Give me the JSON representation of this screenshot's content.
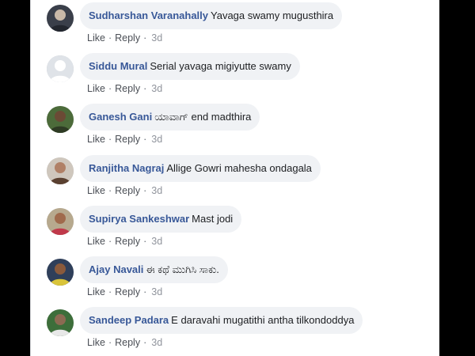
{
  "comments": [
    {
      "author": "Sudharshan Varanahally",
      "text": "Yavaga swamy mugusthira",
      "like": "Like",
      "reply": "Reply",
      "sep": "·",
      "time": "3d",
      "avatar": {
        "bg": "#3a3f4a",
        "fg": "#c9b9a8",
        "shirt": "#22262e"
      }
    },
    {
      "author": "Siddu Mural",
      "text": "Serial yavaga migiyutte swamy",
      "like": "Like",
      "reply": "Reply",
      "sep": "·",
      "time": "3d",
      "avatar": {
        "bg": "#dfe3e8",
        "fg": "#ffffff",
        "shirt": "#ffffff"
      }
    },
    {
      "author": "Ganesh Gani",
      "text": "ಯಾವಾಗ್ end madthira",
      "like": "Like",
      "reply": "Reply",
      "sep": "·",
      "time": "3d",
      "avatar": {
        "bg": "#4c6b3a",
        "fg": "#6b4a35",
        "shirt": "#2e3b24"
      }
    },
    {
      "author": "Ranjitha Nagraj",
      "text": "Allige Gowri mahesha ondagala",
      "like": "Like",
      "reply": "Reply",
      "sep": "·",
      "time": "3d",
      "avatar": {
        "bg": "#cfc7bd",
        "fg": "#b08066",
        "shirt": "#5a4030"
      }
    },
    {
      "author": "Supirya Sankeshwar",
      "text": "Mast jodi",
      "like": "Like",
      "reply": "Reply",
      "sep": "·",
      "time": "3d",
      "avatar": {
        "bg": "#b7a98e",
        "fg": "#a06a4c",
        "shirt": "#c0394a"
      }
    },
    {
      "author": "Ajay Navali",
      "text": "ಈ ಕಥೆ ಮುಗಿಸಿ ಸಾಕು.",
      "like": "Like",
      "reply": "Reply",
      "sep": "·",
      "time": "3d",
      "avatar": {
        "bg": "#2f3f5a",
        "fg": "#8a5a3c",
        "shirt": "#d9c43a"
      }
    },
    {
      "author": "Sandeep Padara",
      "text": "E daravahi mugatithi antha tilkondoddya",
      "like": "Like",
      "reply": "Reply",
      "sep": "·",
      "time": "3d",
      "avatar": {
        "bg": "#3d6e3a",
        "fg": "#8c6a52",
        "shirt": "#e8e8e8"
      }
    }
  ]
}
